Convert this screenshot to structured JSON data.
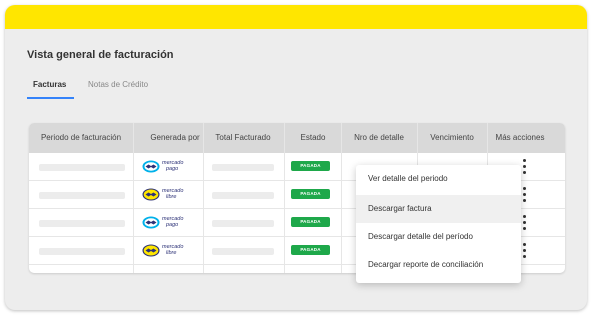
{
  "page": {
    "title": "Vista general de facturación",
    "accent_color": "#ffe600",
    "tab_underline_color": "#3483fa"
  },
  "tabs": [
    {
      "label": "Facturas",
      "active": true
    },
    {
      "label": "Notas de Crédito",
      "active": false
    }
  ],
  "table": {
    "columns": [
      "Periodo de facturación",
      "Generada por",
      "Total Facturado",
      "Estado",
      "Nro de detalle",
      "Vencimiento",
      "Más acciones"
    ],
    "rows": [
      {
        "generated_by": {
          "icon": "mercado-pago-icon",
          "line1": "mercado",
          "line2": "pago"
        },
        "status": "PAGADA"
      },
      {
        "generated_by": {
          "icon": "mercado-libre-icon",
          "line1": "mercado",
          "line2": "libre"
        },
        "status": "PAGADA"
      },
      {
        "generated_by": {
          "icon": "mercado-pago-icon",
          "line1": "mercado",
          "line2": "pago"
        },
        "status": "PAGADA"
      },
      {
        "generated_by": {
          "icon": "mercado-libre-icon",
          "line1": "mercado",
          "line2": "libre"
        },
        "status": "PAGADA"
      }
    ],
    "status_color": "#1ea84a"
  },
  "actions_menu": {
    "items": [
      {
        "label": "Ver detalle del periodo",
        "highlighted": false
      },
      {
        "label": "Descargar factura",
        "highlighted": true
      },
      {
        "label": "Descargar detalle del período",
        "highlighted": false
      },
      {
        "label": "Decargar reporte de conciliación",
        "highlighted": false
      }
    ]
  }
}
